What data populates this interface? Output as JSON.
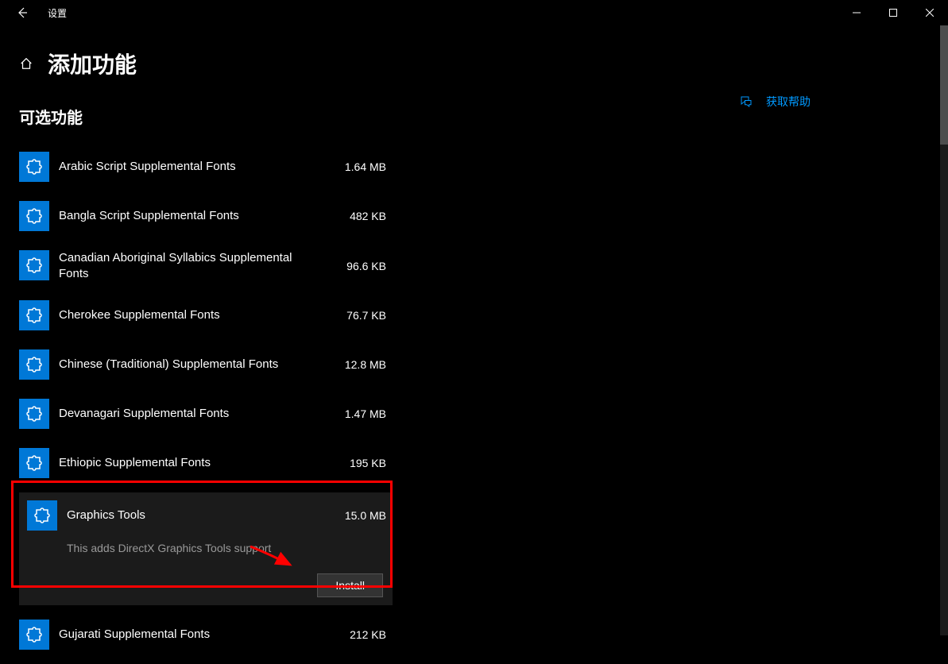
{
  "titlebar": {
    "title": "设置"
  },
  "header": {
    "title": "添加功能"
  },
  "section": {
    "title": "可选功能"
  },
  "help": {
    "label": "获取帮助"
  },
  "features": [
    {
      "name": "Arabic Script Supplemental Fonts",
      "size": "1.64 MB"
    },
    {
      "name": "Bangla Script Supplemental Fonts",
      "size": "482 KB"
    },
    {
      "name": "Canadian Aboriginal Syllabics Supplemental Fonts",
      "size": "96.6 KB"
    },
    {
      "name": "Cherokee Supplemental Fonts",
      "size": "76.7 KB"
    },
    {
      "name": "Chinese (Traditional) Supplemental Fonts",
      "size": "12.8 MB"
    },
    {
      "name": "Devanagari Supplemental Fonts",
      "size": "1.47 MB"
    },
    {
      "name": "Ethiopic Supplemental Fonts",
      "size": "195 KB"
    }
  ],
  "expanded": {
    "name": "Graphics Tools",
    "size": "15.0 MB",
    "desc": "This adds DirectX Graphics Tools support",
    "install": "Install"
  },
  "features_after": [
    {
      "name": "Gujarati Supplemental Fonts",
      "size": "212 KB"
    }
  ]
}
